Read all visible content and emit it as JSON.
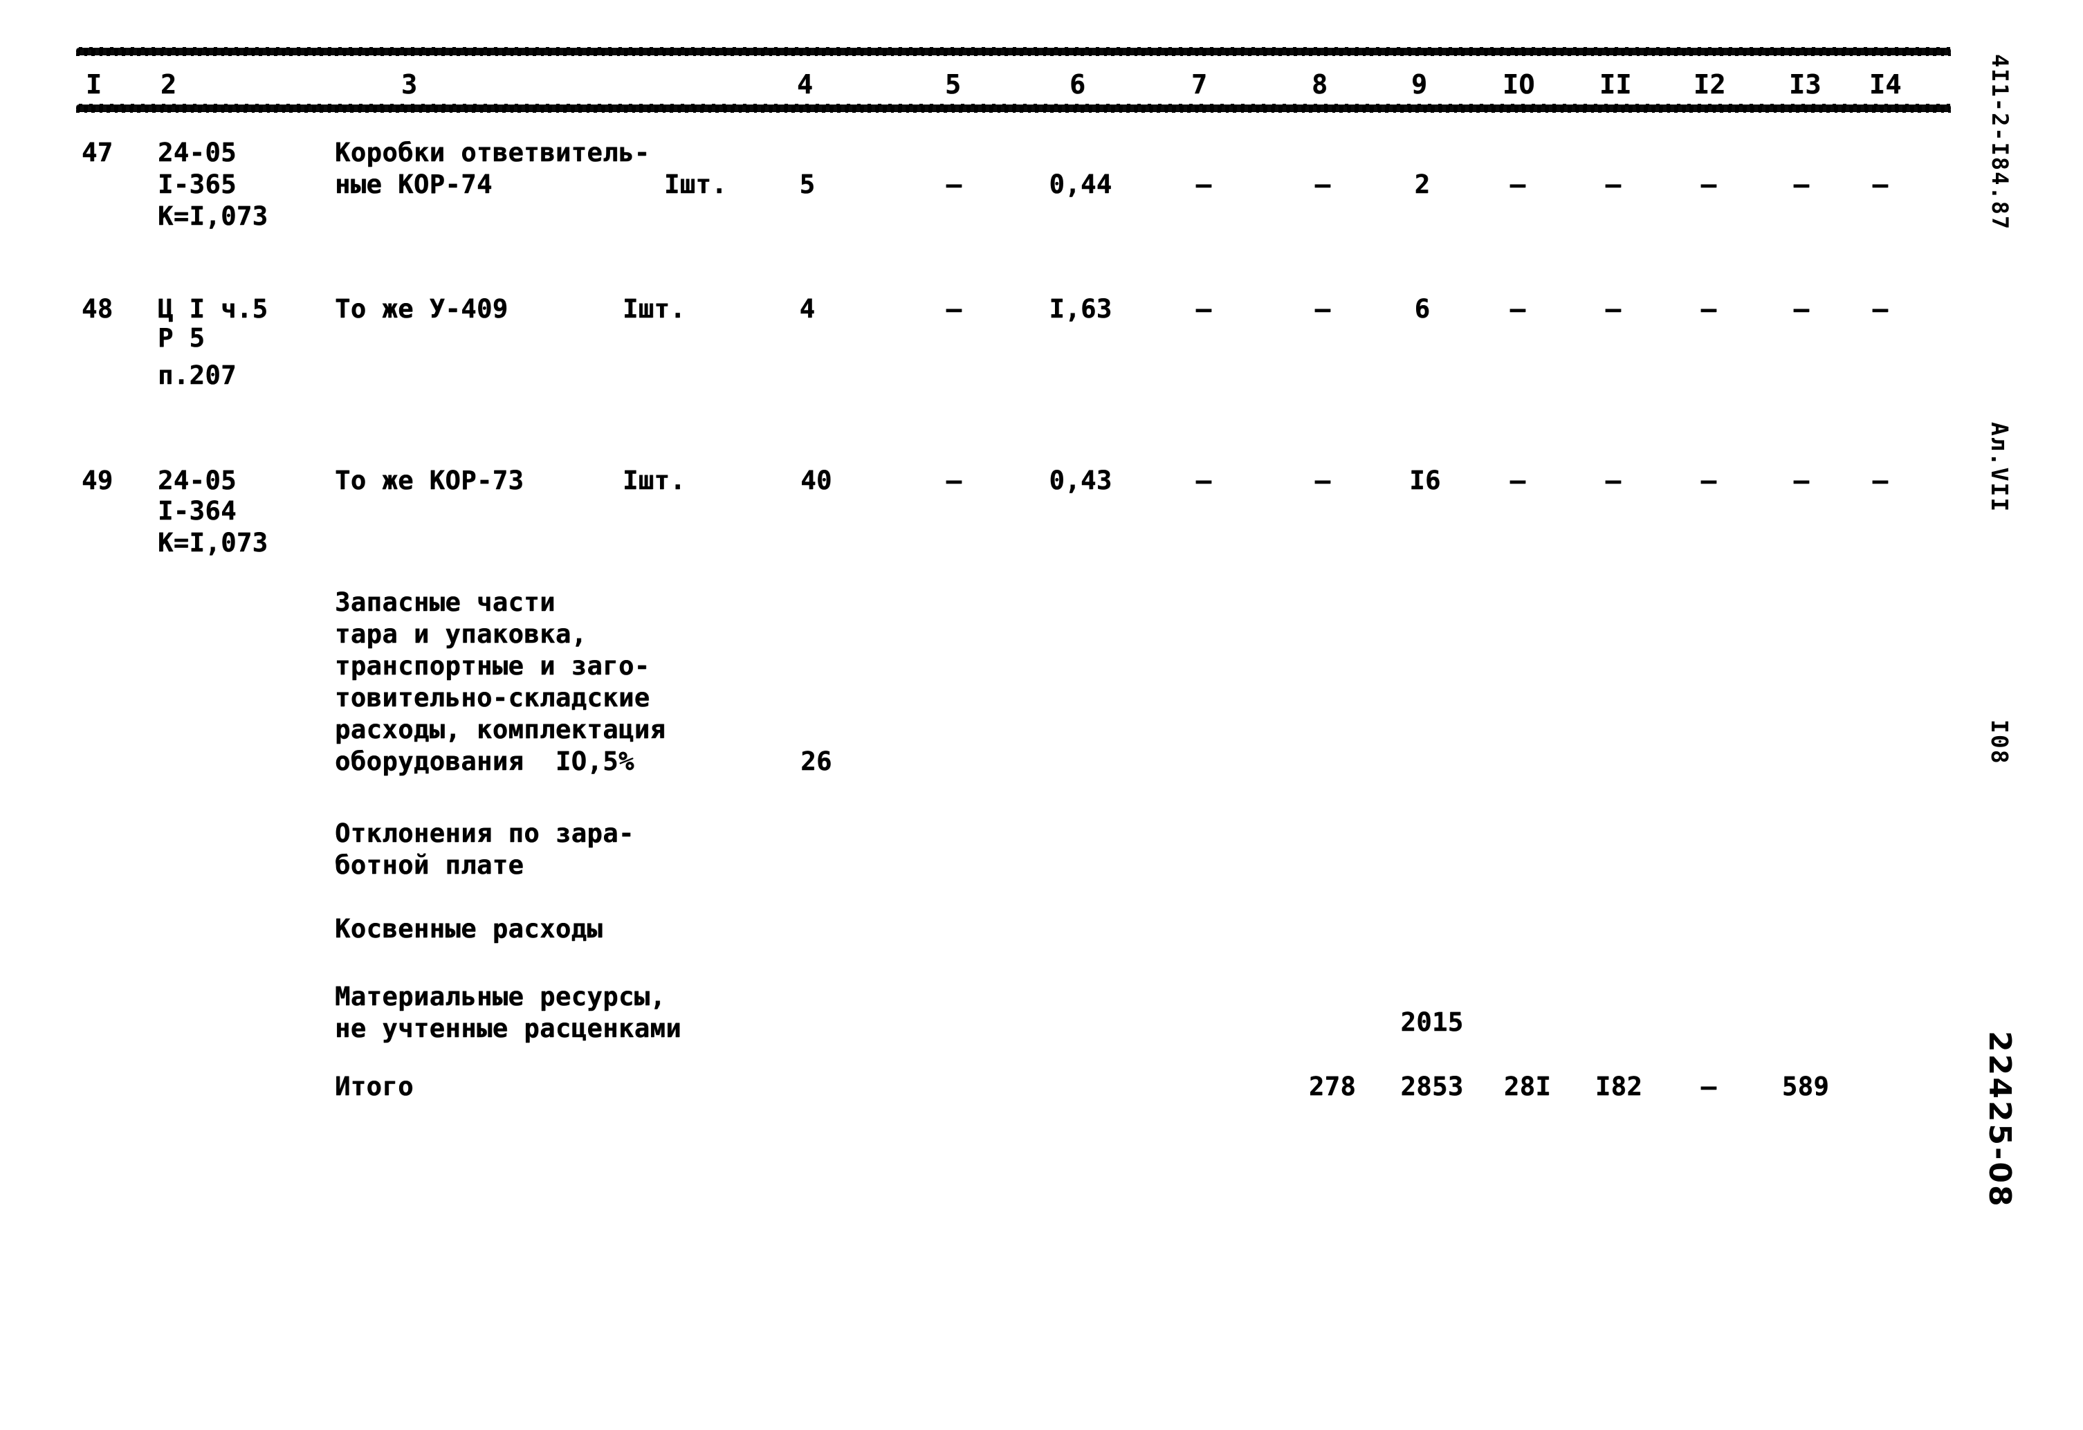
{
  "document": {
    "kind": "scanned-estimate-table",
    "margin_stamps": {
      "code": "4I1-2-I84.87",
      "album": "Ал.VII",
      "page_number": "I08",
      "archive": "22425-08"
    }
  },
  "table": {
    "column_headers": [
      "I",
      "2",
      "3",
      "4",
      "5",
      "6",
      "7",
      "8",
      "9",
      "IO",
      "II",
      "I2",
      "I3",
      "I4"
    ],
    "rows": [
      {
        "no": "47",
        "code_lines": [
          "24-05",
          "I-365",
          "К=I,073"
        ],
        "name_lines": [
          "Коробки ответвитель-",
          "ные КОР-74"
        ],
        "unit": "Iшт.",
        "c4": "5",
        "c5": "–",
        "c6": "0,44",
        "c7": "–",
        "c8": "–",
        "c9": "2",
        "c10": "–",
        "c11": "–",
        "c12": "–",
        "c13": "–",
        "c14": "–"
      },
      {
        "no": "48",
        "code_lines": [
          "Ц I ч.5",
          "Р 5",
          "п.207"
        ],
        "name_lines": [
          "То же У-409"
        ],
        "unit": "Iшт.",
        "c4": "4",
        "c5": "–",
        "c6": "I,63",
        "c7": "–",
        "c8": "–",
        "c9": "6",
        "c10": "–",
        "c11": "–",
        "c12": "–",
        "c13": "–",
        "c14": "–"
      },
      {
        "no": "49",
        "code_lines": [
          "24-05",
          "I-364",
          "К=I,073"
        ],
        "name_lines": [
          "То же КОР-73"
        ],
        "unit": "Iшт.",
        "c4": "40",
        "c5": "–",
        "c6": "0,43",
        "c7": "–",
        "c8": "–",
        "c9": "I6",
        "c10": "–",
        "c11": "–",
        "c12": "–",
        "c13": "–",
        "c14": "–"
      }
    ],
    "summary": {
      "spare_parts": {
        "lines": [
          "Запасные части",
          "тара и упаковка,",
          "транспортные и заго-",
          "товительно-складские",
          "расходы, комплектация",
          "оборудования  IO,5%"
        ],
        "c4": "26"
      },
      "wage_deviation": {
        "lines": [
          "Отклонения по зара-",
          "ботной плате"
        ]
      },
      "indirect_costs": {
        "lines": [
          "Косвенные расходы"
        ]
      },
      "material_resources": {
        "lines": [
          "Материальные ресурсы,",
          "не учтенные расценками"
        ],
        "c9": "2015"
      },
      "total": {
        "label": "Итого",
        "c8": "278",
        "c9": "2853",
        "c10": "28I",
        "c11": "I82",
        "c12": "–",
        "c13": "589"
      }
    }
  }
}
